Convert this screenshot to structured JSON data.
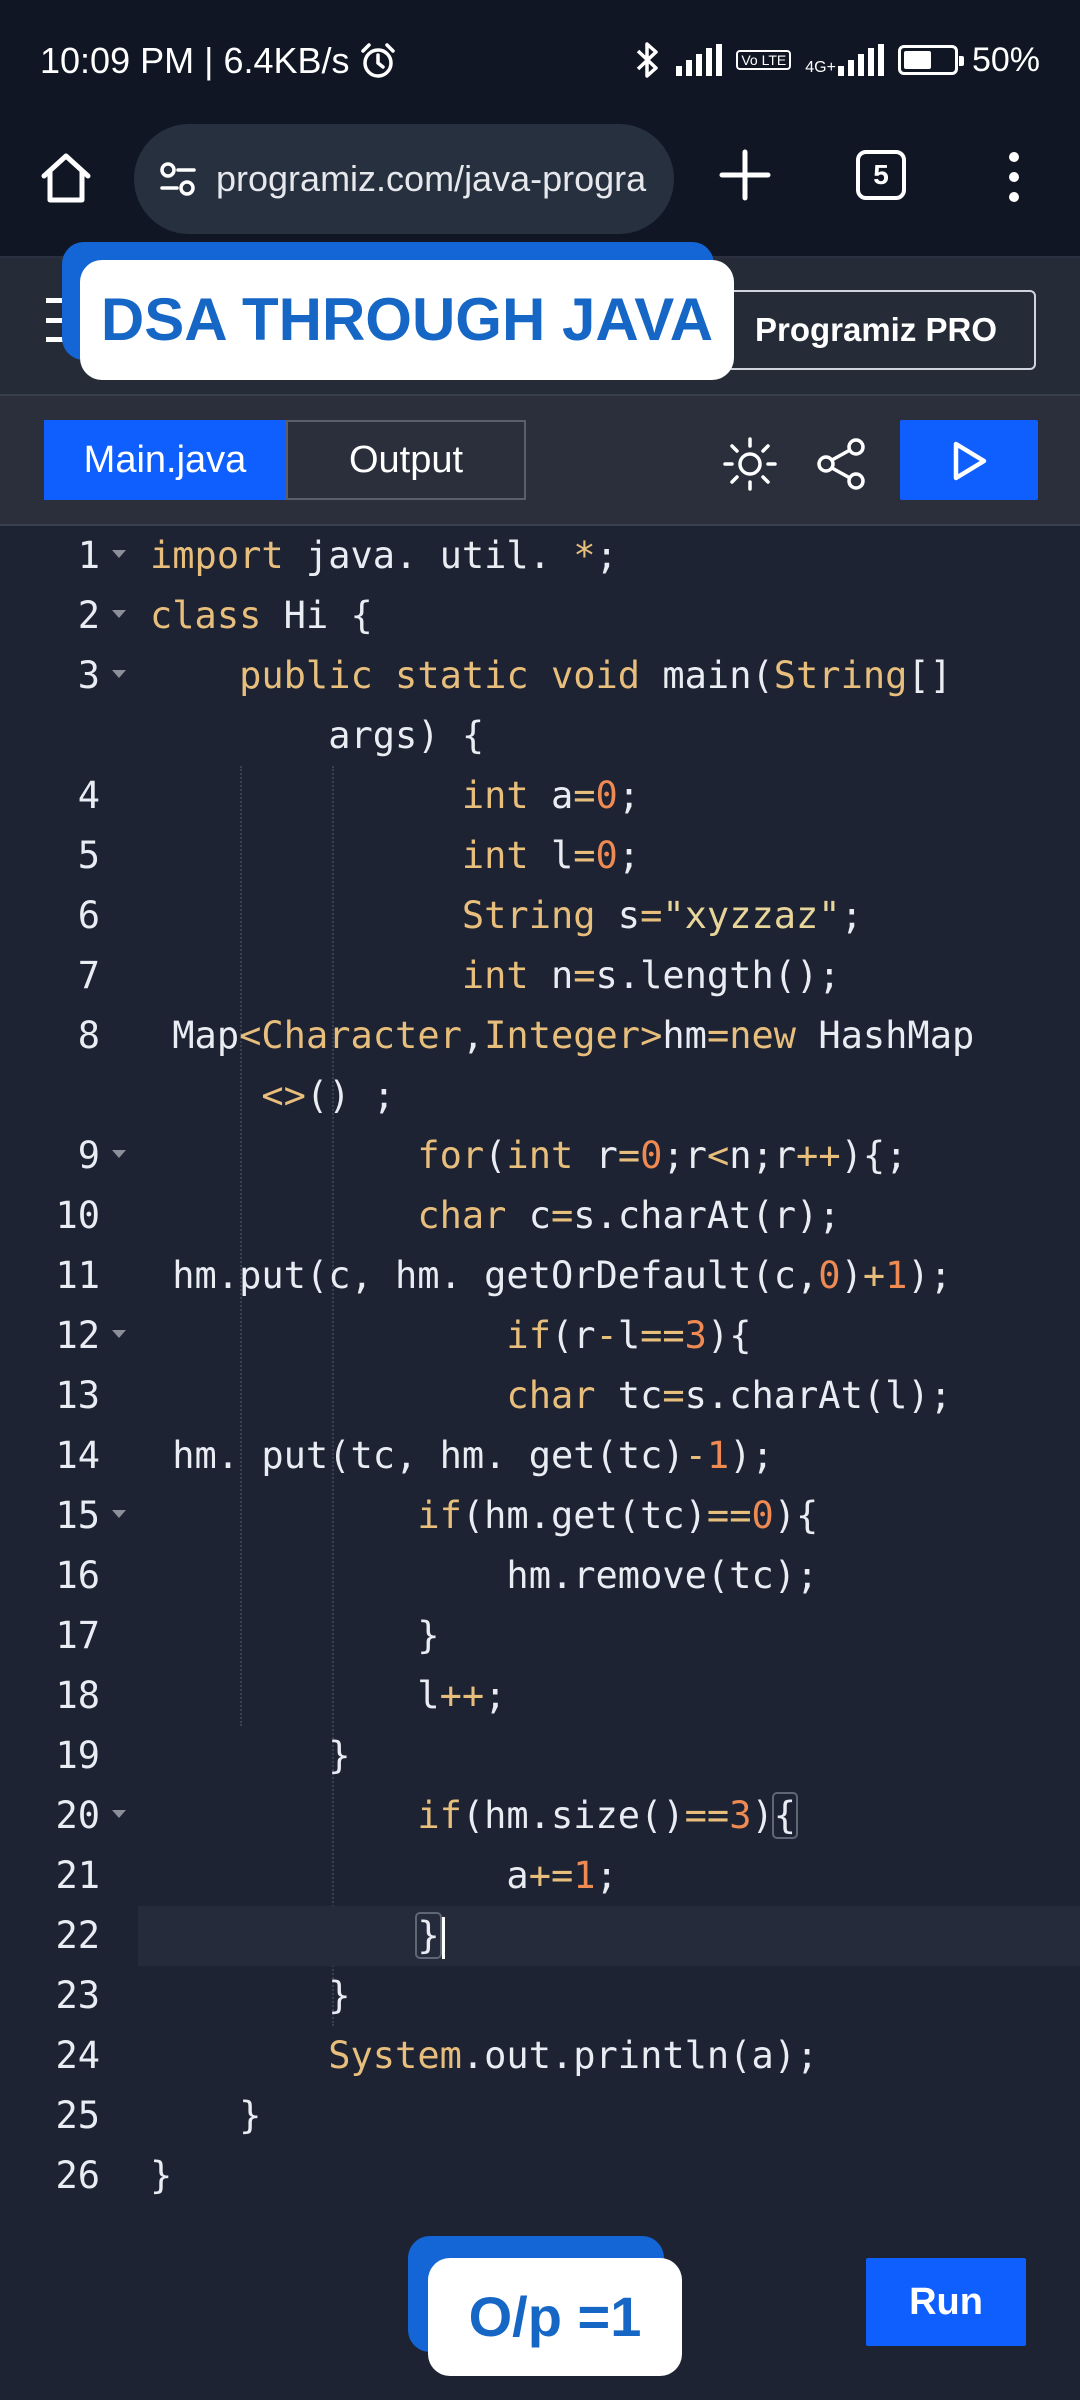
{
  "status_bar": {
    "time_speed": "10:09 PM | 6.4KB/s",
    "network": "4G+",
    "volte": "Vo LTE",
    "battery": "50%",
    "battery_level": 0.5
  },
  "browser": {
    "url": "programiz.com/java-progra",
    "tab_count": "5"
  },
  "site_header": {
    "pro_button": "Programiz PRO"
  },
  "banner": {
    "text": "DSA THROUGH JAVA"
  },
  "editor": {
    "tab_main": "Main.java",
    "tab_output": "Output",
    "code_lines": [
      {
        "num": "1",
        "fold": true,
        "html": "<span class='k'>import</span> java. util. <span class='o'>*</span>;"
      },
      {
        "num": "2",
        "fold": true,
        "html": "<span class='k'>class</span> Hi {"
      },
      {
        "num": "3",
        "fold": true,
        "html": "    <span class='k'>public</span> <span class='k'>static</span> <span class='k'>void</span> main(<span class='k'>String</span>[]"
      },
      {
        "num": "",
        "fold": false,
        "html": "        args) {"
      },
      {
        "num": "4",
        "fold": false,
        "html": "              <span class='k'>int</span> a<span class='o'>=</span><span class='n'>0</span>;"
      },
      {
        "num": "5",
        "fold": false,
        "html": "              <span class='k'>int</span> l<span class='o'>=</span><span class='n'>0</span>;"
      },
      {
        "num": "6",
        "fold": false,
        "html": "              <span class='k'>String</span> s<span class='o'>=</span><span class='s'>\"xyzzaz\"</span>;"
      },
      {
        "num": "7",
        "fold": false,
        "html": "              <span class='k'>int</span> n<span class='o'>=</span>s.length();"
      },
      {
        "num": "8",
        "fold": false,
        "html": " Map<span class='o'>&lt;</span><span class='k'>Character</span>,<span class='k'>Integer</span><span class='o'>&gt;</span>hm<span class='o'>=</span><span class='k'>new</span> HashMap"
      },
      {
        "num": "",
        "fold": false,
        "html": "     <span class='o'>&lt;&gt;</span>() ;"
      },
      {
        "num": "9",
        "fold": true,
        "html": "            <span class='k'>for</span>(<span class='k'>int</span> r<span class='o'>=</span><span class='n'>0</span>;r<span class='o'>&lt;</span>n;r<span class='o'>++</span>){;"
      },
      {
        "num": "10",
        "fold": false,
        "html": "            <span class='k'>char</span> c<span class='o'>=</span>s.charAt(r);"
      },
      {
        "num": "11",
        "fold": false,
        "html": " hm.put(c, hm. getOrDefault(c,<span class='n'>0</span>)<span class='o'>+</span><span class='n'>1</span>);"
      },
      {
        "num": "12",
        "fold": true,
        "html": "                <span class='k'>if</span>(r<span class='o'>-</span>l<span class='o'>==</span><span class='n'>3</span>){"
      },
      {
        "num": "13",
        "fold": false,
        "html": "                <span class='k'>char</span> tc<span class='o'>=</span>s.charAt(l);"
      },
      {
        "num": "14",
        "fold": false,
        "html": " hm. put(tc, hm. get(tc)<span class='o'>-</span><span class='n'>1</span>);"
      },
      {
        "num": "15",
        "fold": true,
        "html": "            <span class='k'>if</span>(hm.get(tc)<span class='o'>==</span><span class='n'>0</span>){"
      },
      {
        "num": "16",
        "fold": false,
        "html": "                hm.remove(tc);"
      },
      {
        "num": "17",
        "fold": false,
        "html": "            }"
      },
      {
        "num": "18",
        "fold": false,
        "html": "            l<span class='o'>++</span>;"
      },
      {
        "num": "19",
        "fold": false,
        "html": "        }"
      },
      {
        "num": "20",
        "fold": true,
        "html": "            <span class='k'>if</span>(hm.size()<span class='o'>==</span><span class='n'>3</span>)<span class='brace-box'>{</span>"
      },
      {
        "num": "21",
        "fold": false,
        "html": "                a<span class='o'>+=</span><span class='n'>1</span>;"
      },
      {
        "num": "22",
        "fold": false,
        "html": "            <span class='brace-box'>}</span><span class='cursor'></span>"
      },
      {
        "num": "23",
        "fold": false,
        "html": "        }"
      },
      {
        "num": "24",
        "fold": false,
        "html": "        <span class='k'>System</span>.out.println(a);"
      },
      {
        "num": "25",
        "fold": false,
        "html": "    }"
      },
      {
        "num": "26",
        "fold": false,
        "html": "}"
      }
    ]
  },
  "output_label": {
    "text": "O/p =1"
  },
  "run_button": {
    "label": "Run"
  },
  "colors": {
    "accent": "#0f5fff",
    "keyword": "#e8be7c",
    "number": "#ef8a52",
    "string": "#e8d59a",
    "editor_bg": "#1d2333"
  }
}
